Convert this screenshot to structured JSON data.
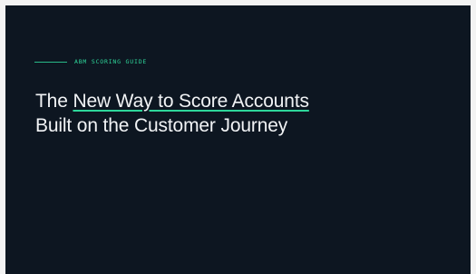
{
  "hero": {
    "eyebrow": "ABM SCORING GUIDE",
    "headline": {
      "line1_prefix": "The",
      "line1_highlight": "New Way to Score Accounts",
      "line2": "Built on the Customer Journey"
    }
  },
  "colors": {
    "background": "#0d1621",
    "accent": "#2ed69a",
    "text": "#f1f3f5"
  }
}
